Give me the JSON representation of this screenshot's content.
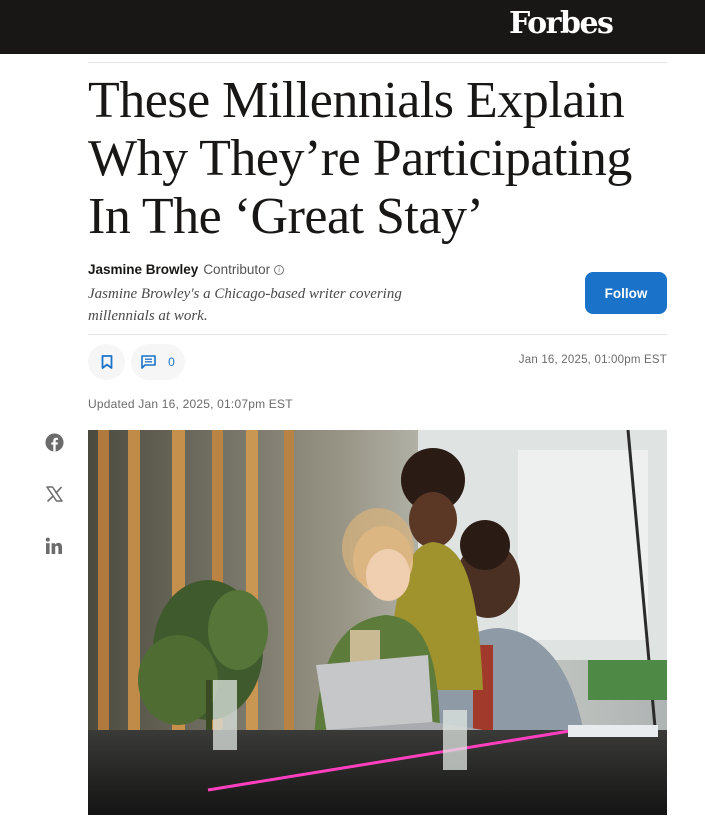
{
  "brand": {
    "logo": "Forbes"
  },
  "article": {
    "headline": "These Millennials Explain Why They’re Participating In The ‘Great Stay’",
    "author": {
      "name": "Jasmine Browley",
      "role": "Contributor",
      "bio": "Jasmine Browley's a Chicago-based writer covering millennials at work."
    },
    "follow_label": "Follow",
    "comment_count": "0",
    "published": "Jan 16, 2025, 01:00pm EST",
    "updated": "Updated Jan 16, 2025, 01:07pm EST"
  },
  "share": {
    "icons": [
      "facebook-icon",
      "x-icon",
      "linkedin-icon"
    ]
  },
  "colors": {
    "topbar": "#181716",
    "accent": "#1a73c8",
    "text": "#181716",
    "muted": "#6b6b6b"
  }
}
